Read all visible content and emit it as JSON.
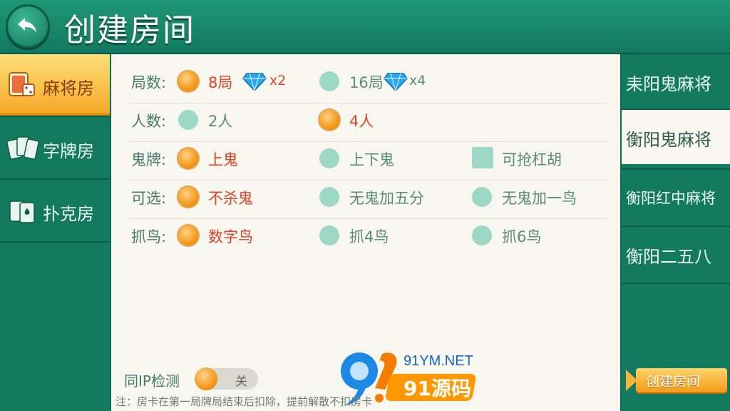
{
  "header": {
    "title": "创建房间",
    "back_icon": "back-arrow-icon"
  },
  "left_nav": [
    {
      "label": "麻将房",
      "icon": "mahjong-tile-icon",
      "active": true
    },
    {
      "label": "字牌房",
      "icon": "zipai-cards-icon",
      "active": false
    },
    {
      "label": "扑克房",
      "icon": "poker-cards-icon",
      "active": false
    }
  ],
  "rows": {
    "rounds": {
      "label": "局数:",
      "opt1": "8局",
      "opt1_mult": "x2",
      "opt2": "16局",
      "opt2_mult": "x4"
    },
    "players": {
      "label": "人数:",
      "opt1": "2人",
      "opt2": "4人"
    },
    "ghost": {
      "label": "鬼牌:",
      "opt1": "上鬼",
      "opt2": "上下鬼",
      "opt3": "可抢杠胡"
    },
    "optional": {
      "label": "可选:",
      "opt1": "不杀鬼",
      "opt2": "无鬼加五分",
      "opt3": "无鬼加一鸟"
    },
    "birds": {
      "label": "抓鸟:",
      "opt1": "数字鸟",
      "opt2": "抓4鸟",
      "opt3": "抓6鸟"
    }
  },
  "ip_check": {
    "label": "同IP检测",
    "state": "关"
  },
  "note": "注：房卡在第一局牌局结束后扣除，提前解散不扣房卡",
  "watermark": {
    "top": "91YM.NET",
    "bottom": "91源码"
  },
  "right_nav": [
    {
      "label": "耒阳鬼麻将",
      "active": false
    },
    {
      "label": "衡阳鬼麻将",
      "active": true
    },
    {
      "label": "衡阳红中麻将",
      "active": false
    },
    {
      "label": "衡阳二五八",
      "active": false
    }
  ],
  "create_button": {
    "label": "创建房间"
  },
  "colors": {
    "accent": "#f39a1a",
    "selected_text": "#e2412a",
    "panel_green": "#137a60"
  }
}
